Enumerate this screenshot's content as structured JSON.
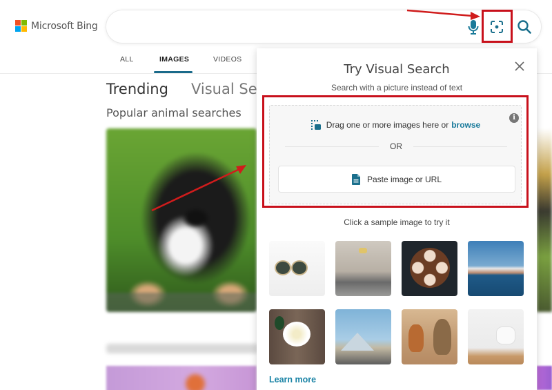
{
  "header": {
    "logo_text": "Microsoft Bing",
    "logo_colors": [
      "#f25022",
      "#7fba00",
      "#00a4ef",
      "#ffb900"
    ],
    "search": {
      "value": "",
      "placeholder": ""
    },
    "icons": [
      "microphone-icon",
      "visual-search-icon",
      "search-icon"
    ]
  },
  "nav": {
    "tabs": [
      {
        "label": "ALL",
        "active": false
      },
      {
        "label": "IMAGES",
        "active": true
      },
      {
        "label": "VIDEOS",
        "active": false
      }
    ]
  },
  "background": {
    "tabs": [
      "Trending",
      "Visual Sea"
    ],
    "section_title": "Popular animal searches"
  },
  "visual_search_panel": {
    "title": "Try Visual Search",
    "subtitle": "Search with a picture instead of text",
    "drop_text": "Drag one or more images here or",
    "browse_label": "browse",
    "or_label": "OR",
    "paste_label": "Paste image or URL",
    "sample_label": "Click a sample image to try it",
    "samples": [
      {
        "subject": "sunglasses"
      },
      {
        "subject": "dining room"
      },
      {
        "subject": "latte art coffee cups"
      },
      {
        "subject": "sydney opera house"
      },
      {
        "subject": "white rose"
      },
      {
        "subject": "louvre pyramid"
      },
      {
        "subject": "corgi and yorkie dogs"
      },
      {
        "subject": "white chair"
      }
    ],
    "learn_more_label": "Learn more"
  },
  "colors": {
    "accent": "#17799a",
    "annotation_red": "#c8101b",
    "tab_underline": "#1a6a8a"
  }
}
